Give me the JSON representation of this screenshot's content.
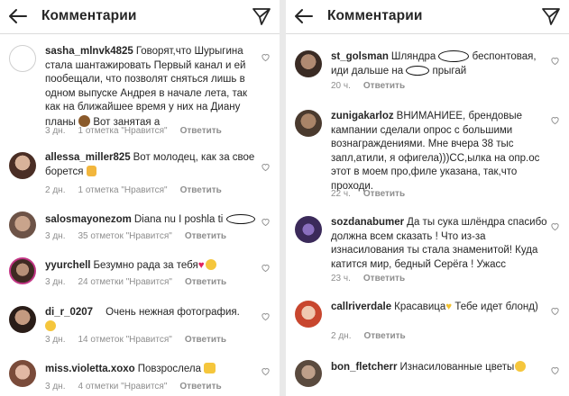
{
  "left": {
    "title": "Комментарии",
    "comments": [
      {
        "user": "sasha_mlnvk4825",
        "text": "Говорят,что Шурыгина стала шантажировать Первый канал и ей пообещали, что позволят сняться лишь в одном выпуске Андрея в начале лета, так как на ближайшее время у них на Диану планы",
        "text_after": "Вот занятая а",
        "time": "3 дн.",
        "likes": "1 отметка \"Нравится\"",
        "reply": "Ответить"
      },
      {
        "user": "allessa_miller825",
        "text": "Вот молодец, как за свое борется",
        "time": "2 дн.",
        "likes": "1 отметка \"Нравится\"",
        "reply": "Ответить"
      },
      {
        "user": "salosmayonezom",
        "text": "Diana nu I poshla ti",
        "time": "3 дн.",
        "likes": "35 отметок \"Нравится\"",
        "reply": "Ответить"
      },
      {
        "user": "yyurchell",
        "text": "Безумно рада за тебя",
        "time": "3 дн.",
        "likes": "24 отметки \"Нравится\"",
        "reply": "Ответить"
      },
      {
        "user": "di_r_0207",
        "text": "Очень нежная фотография.",
        "time": "3 дн.",
        "likes": "14 отметок \"Нравится\"",
        "reply": "Ответить"
      },
      {
        "user": "miss.violetta.xoxo",
        "text": "Повзрослела",
        "time": "3 дн.",
        "likes": "4 отметки \"Нравится\"",
        "reply": "Ответить"
      }
    ]
  },
  "right": {
    "title": "Комментарии",
    "comments": [
      {
        "user": "st_golsman",
        "text": "Шляндра",
        "text_mid": "беспонтовая, иди дальше на",
        "text_end": "прыгай",
        "time": "20 ч.",
        "reply": "Ответить"
      },
      {
        "user": "zunigakarloz",
        "text": "ВНИМАНИЕЕ, брендовые кампании сделали опрос с большими вознаграждениями. Мне вчера 38 тыс запл,атили, я офигела)))СС,ылка на опр.ос этот в моем про,филе указана, так,что проходи.",
        "time": "22 ч.",
        "reply": "Ответить"
      },
      {
        "user": "sozdanabumer",
        "text": "Да ты сука шлёндра спасибо должна всем сказать ! Что из-за изнасилования ты стала знаменитой! Куда катится мир, бедный Серёга ! Ужасс",
        "time": "23 ч.",
        "reply": "Ответить"
      },
      {
        "user": "callriverdale",
        "text": "Красавица",
        "text_after": "Тебе идет блонд)",
        "time": "2 дн.",
        "reply": "Ответить"
      },
      {
        "user": "bon_fletcherr",
        "text": "Изнасилованные цветы",
        "time": "",
        "reply": ""
      }
    ]
  },
  "colors": {
    "text": "#262626",
    "meta": "#8e8e8e",
    "border": "#dbdbdb"
  }
}
